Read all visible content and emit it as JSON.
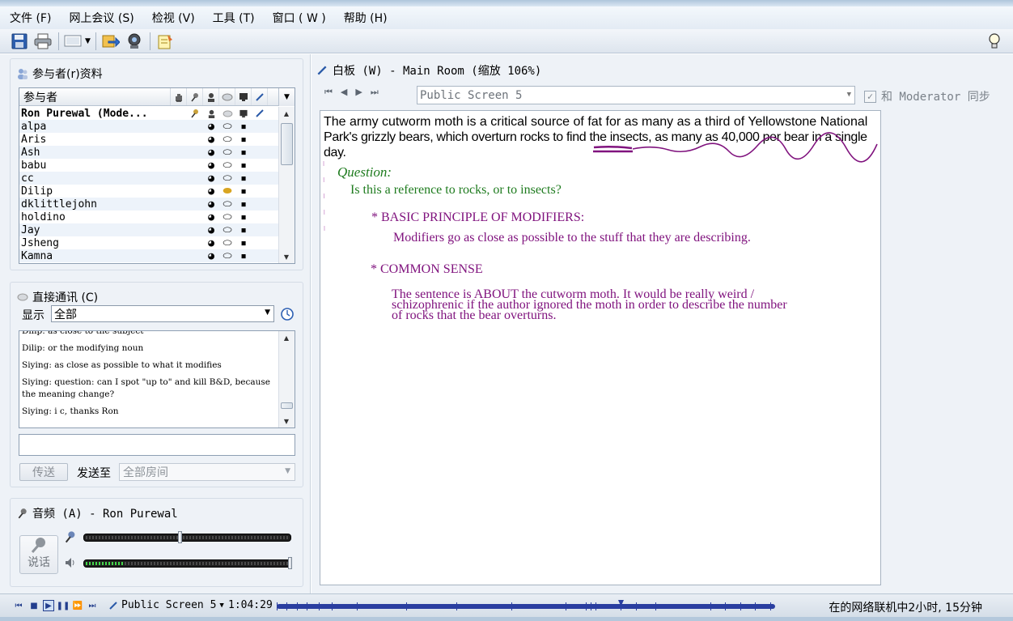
{
  "menu": [
    "文件 (F)",
    "网上会议 (S)",
    "检视 (V)",
    "工具 (T)",
    "窗口 ( W )",
    "帮助 (H)"
  ],
  "toolbar": {
    "icons": [
      "save-icon",
      "print-icon",
      "screen-layout-icon",
      "share-icon",
      "webcam-icon",
      "notes-icon"
    ],
    "right_icon": "lightbulb-icon"
  },
  "participants_panel": {
    "title": "参与者(r)资料",
    "header_label": "参与者",
    "header_icons": [
      "raise-hand-icon",
      "microphone-icon",
      "webcam-user-icon",
      "chat-bubble-icon",
      "monitor-icon",
      "pencil-icon"
    ],
    "rows": [
      {
        "name": "Ron Purewal (Mode...",
        "moderator": true
      },
      {
        "name": "alpa",
        "moderator": false
      },
      {
        "name": "Aris",
        "moderator": false
      },
      {
        "name": "Ash",
        "moderator": false
      },
      {
        "name": "babu",
        "moderator": false
      },
      {
        "name": "cc",
        "moderator": false
      },
      {
        "name": "Dilip",
        "moderator": false
      },
      {
        "name": "dklittlejohn",
        "moderator": false
      },
      {
        "name": "holdino",
        "moderator": false
      },
      {
        "name": "Jay",
        "moderator": false
      },
      {
        "name": "Jsheng",
        "moderator": false
      },
      {
        "name": "Kamna",
        "moderator": false
      }
    ]
  },
  "chat_panel": {
    "title": "直接通讯 (C)",
    "show_label": "显示",
    "show_value": "全部",
    "messages": [
      "Dilip: as close to the subject",
      "Dilip: or the modifying noun",
      "Siying: as close as possible to what it modifies",
      "Siying: question: can I spot \"up to\" and kill B&D, because the meaning change?",
      "Siying: i c, thanks Ron"
    ],
    "send_label": "传送",
    "send_to_label": "发送至",
    "send_to_value": "全部房间"
  },
  "audio_panel": {
    "title": "音频 (A) - Ron Purewal",
    "talk_label": "说话",
    "mic_level": 0.5,
    "speaker_level": 0.18
  },
  "whiteboard": {
    "title": "白板 (W) - Main Room (缩放 106%)",
    "screen_select": "Public Screen 5",
    "sync_label": "和 Moderator 同步",
    "sync_checked": "✓",
    "passage_line1": "The army cutworm moth is a critical source of fat for as many as a third of Yellowstone National",
    "passage_line2": "Park's grizzly bears, which overturn rocks to find the insects, as many as 40,000 per bear in a single day.",
    "question_label": "Question:",
    "question_text": "Is this a reference to rocks, or to insects?",
    "principle_heading": "* BASIC PRINCIPLE OF MODIFIERS:",
    "principle_text": "Modifiers go as close as possible to the stuff that they are describing.",
    "common_sense_heading": "* COMMON SENSE",
    "common_sense_line1": "The sentence is ABOUT the cutworm moth.  It would be really weird /",
    "common_sense_line2": "schizophrenic if the author ignored the moth in order to describe the number",
    "common_sense_line3": "of rocks that the bear overturns."
  },
  "playback": {
    "screen_label": "Public Screen 5",
    "time": "1:04:29",
    "progress": 0.69,
    "status": "在的网络联机中2小时, 15分钟"
  },
  "colors": {
    "handwriting_green": "#1e7b1e",
    "handwriting_purple": "#80137e",
    "timeline_blue": "#2a3ea0"
  }
}
